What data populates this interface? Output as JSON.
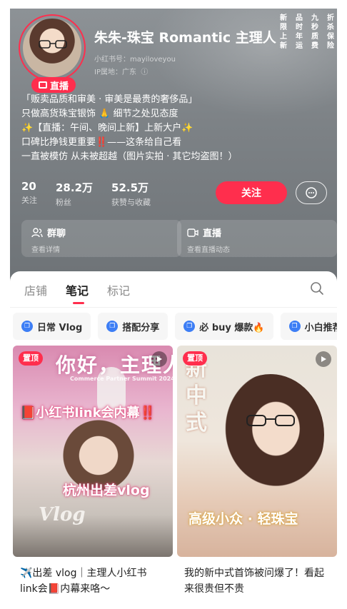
{
  "profile": {
    "name": "朱朱-珠宝 Romantic 主理人",
    "red_id": "小红书号：mayiloveyou",
    "ip_location": "IP属地：广东",
    "live_label": "直播"
  },
  "promises": [
    "新",
    "品",
    "九",
    "折",
    "限",
    "时",
    "秒",
    "杀",
    "上",
    "年",
    "质",
    "保",
    "新",
    "运",
    "费",
    "险"
  ],
  "bio": [
    "「贩卖品质和审美 · 审美是最贵的奢侈品」",
    "只做高货珠宝银饰 🙏 细节之处见态度",
    "✨【直播：午间、晚间上新】上新大户✨",
    "口碑比挣钱更重要‼️——这条给自己看",
    "一直被模仿 从未被超越（图片实拍 · 其它均盗图！）"
  ],
  "stats": [
    {
      "value": "20",
      "label": "关注"
    },
    {
      "value": "28.2万",
      "label": "粉丝"
    },
    {
      "value": "52.5万",
      "label": "获赞与收藏"
    }
  ],
  "actions": {
    "follow": "关注"
  },
  "cards": [
    {
      "title": "群聊",
      "subtitle": "查看详情"
    },
    {
      "title": "直播",
      "subtitle": "查看直播动态"
    }
  ],
  "tabs": [
    "店铺",
    "笔记",
    "标记"
  ],
  "active_tab": "笔记",
  "chips": [
    "日常 Vlog",
    "搭配分享",
    "必 buy 爆款🔥",
    "小白推荐"
  ],
  "notes": [
    {
      "pinned": "置顶",
      "cover_text": [
        "你好，主理人",
        "Commerce Partner Summit 2024",
        "📕小红书link会内幕‼️",
        "杭州出差vlog",
        "Vlog"
      ],
      "title": "✈️出差 vlog｜主理人小红书 link会📕内幕来咯～"
    },
    {
      "pinned": "置顶",
      "cover_text": [
        "新中式",
        "高级小众 · 轻珠宝"
      ],
      "title": "我的新中式首饰被问爆了！看起来很贵但不贵"
    }
  ],
  "colors": {
    "accent": "#ff2e4d",
    "chip_icon": "#3d7ef5"
  }
}
